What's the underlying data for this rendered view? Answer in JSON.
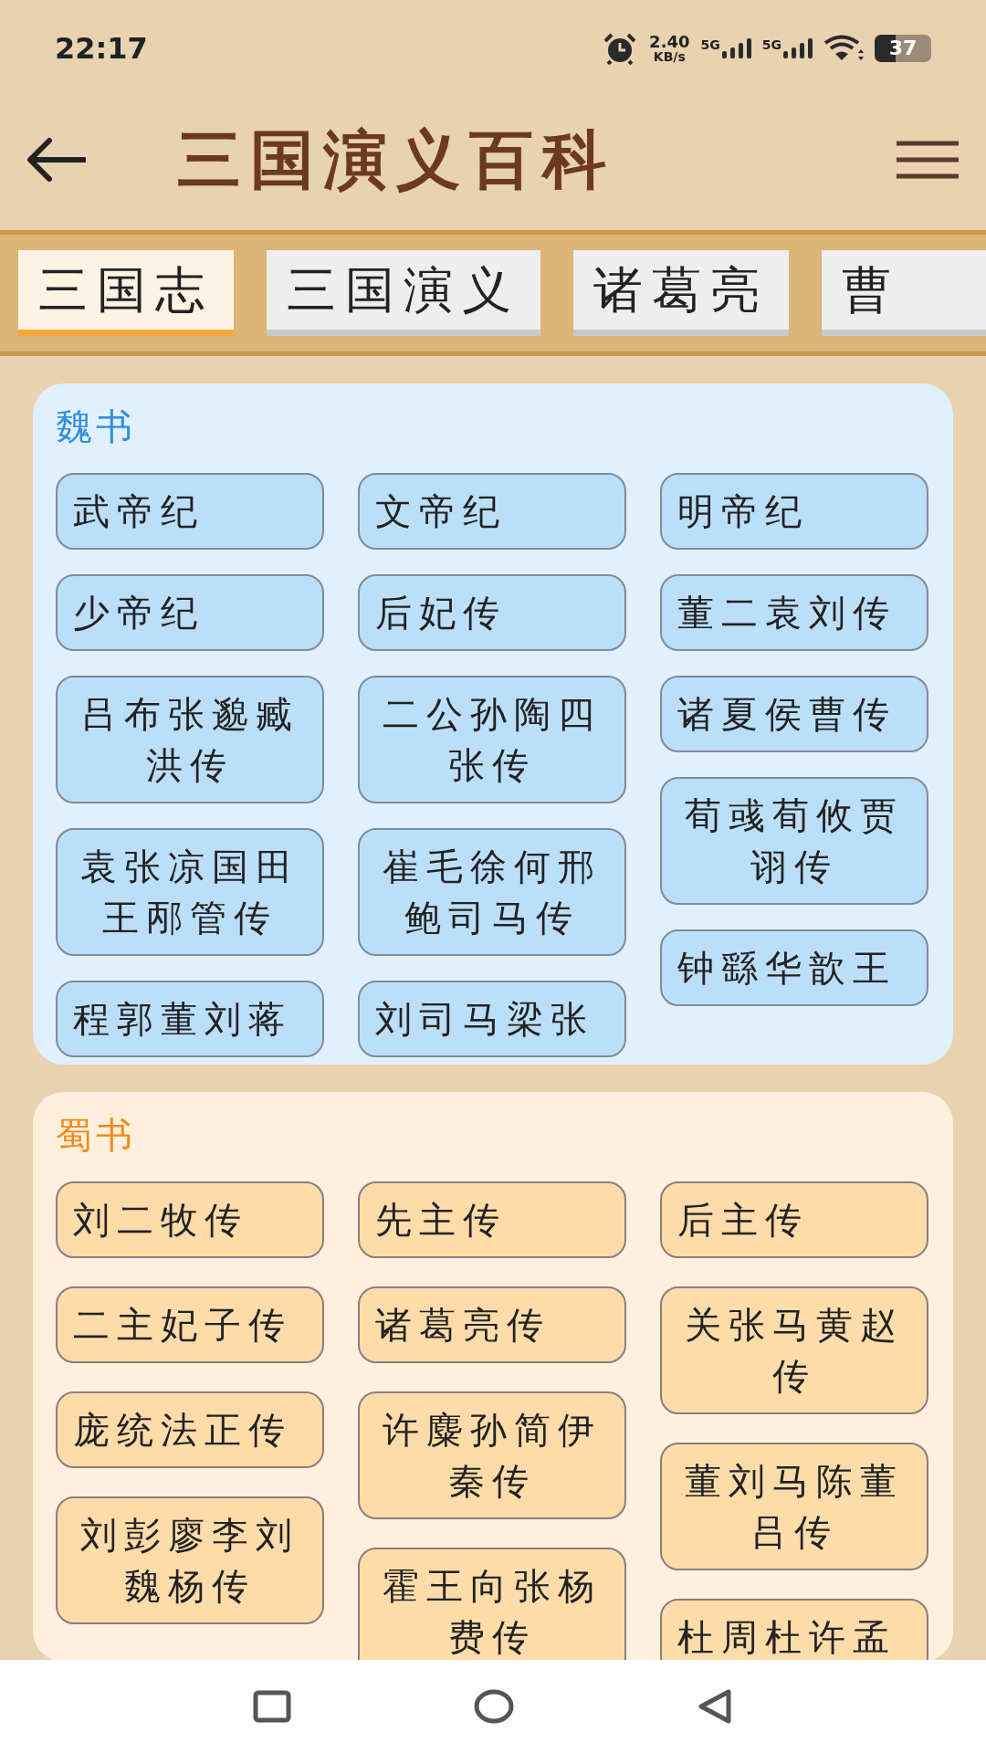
{
  "status_bar": {
    "time": "22:17",
    "net_speed": "2.40",
    "net_unit": "KB/s",
    "signals": [
      "5G",
      "5G"
    ],
    "battery": "37"
  },
  "header": {
    "title": "三国演义百科"
  },
  "tabs": [
    {
      "label": "三国志",
      "selected": true
    },
    {
      "label": "三国演义",
      "selected": false
    },
    {
      "label": "诸葛亮",
      "selected": false
    },
    {
      "label": "曹",
      "selected": false
    }
  ],
  "sections": [
    {
      "title": "魏书",
      "kind": "wei",
      "columns": [
        [
          "武帝纪",
          "少帝纪",
          "吕布张邈臧洪传",
          "袁张凉国田王邴管传",
          "程郭董刘蒋"
        ],
        [
          "文帝纪",
          "后妃传",
          "二公孙陶四张传",
          "崔毛徐何邢鲍司马传",
          "刘司马梁张"
        ],
        [
          "明帝纪",
          "董二袁刘传",
          "诸夏侯曹传",
          "荀彧荀攸贾诩传",
          "钟繇华歆王"
        ]
      ]
    },
    {
      "title": "蜀书",
      "kind": "shu",
      "columns": [
        [
          "刘二牧传",
          "二主妃子传",
          "庞统法正传",
          "刘彭廖李刘魏杨传"
        ],
        [
          "先主传",
          "诸葛亮传",
          "许麋孙简伊秦传",
          "霍王向张杨费传"
        ],
        [
          "后主传",
          "关张马黄赵传",
          "董刘马陈董吕传",
          "杜周杜许孟"
        ]
      ]
    }
  ]
}
